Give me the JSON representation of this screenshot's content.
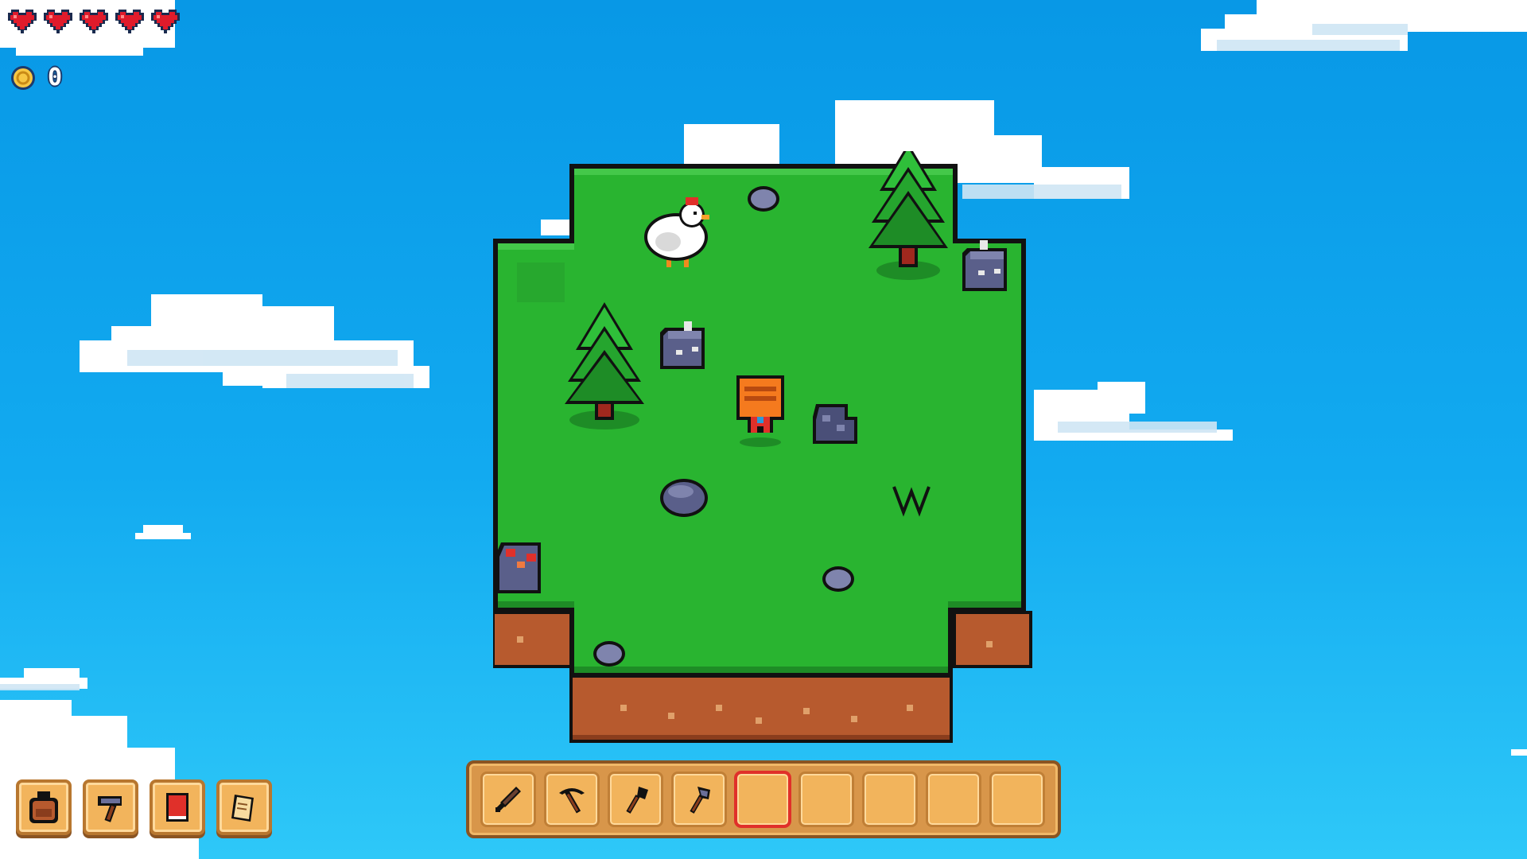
{
  "hud": {
    "hearts": 5,
    "coins": "0",
    "heart_icon": "heart-icon",
    "coin_icon": "coin-icon"
  },
  "menu": {
    "items": [
      {
        "name": "backpack",
        "icon": "backpack-icon"
      },
      {
        "name": "crafting",
        "icon": "hammer-icon"
      },
      {
        "name": "book",
        "icon": "book-icon"
      },
      {
        "name": "quests",
        "icon": "scroll-icon"
      }
    ]
  },
  "hotbar": {
    "selected_slot": 5,
    "slots": [
      {
        "item": "sword-icon"
      },
      {
        "item": "pickaxe-icon"
      },
      {
        "item": "shovel-icon"
      },
      {
        "item": "axe-icon"
      },
      {
        "item": ""
      },
      {
        "item": ""
      },
      {
        "item": ""
      },
      {
        "item": ""
      },
      {
        "item": ""
      }
    ]
  },
  "world": {
    "entities": [
      "tree",
      "tree",
      "chicken",
      "player",
      "rock",
      "rock",
      "rock",
      "coal-ore",
      "copper-ore",
      "grass-tuft",
      "pebble"
    ]
  },
  "colors": {
    "sky_top": "#0898e6",
    "sky_bottom": "#2ec8f8",
    "grass": "#29b430",
    "dirt": "#b75a2e",
    "wood_ui": "#f2b45c",
    "heart": "#e01b2b"
  }
}
